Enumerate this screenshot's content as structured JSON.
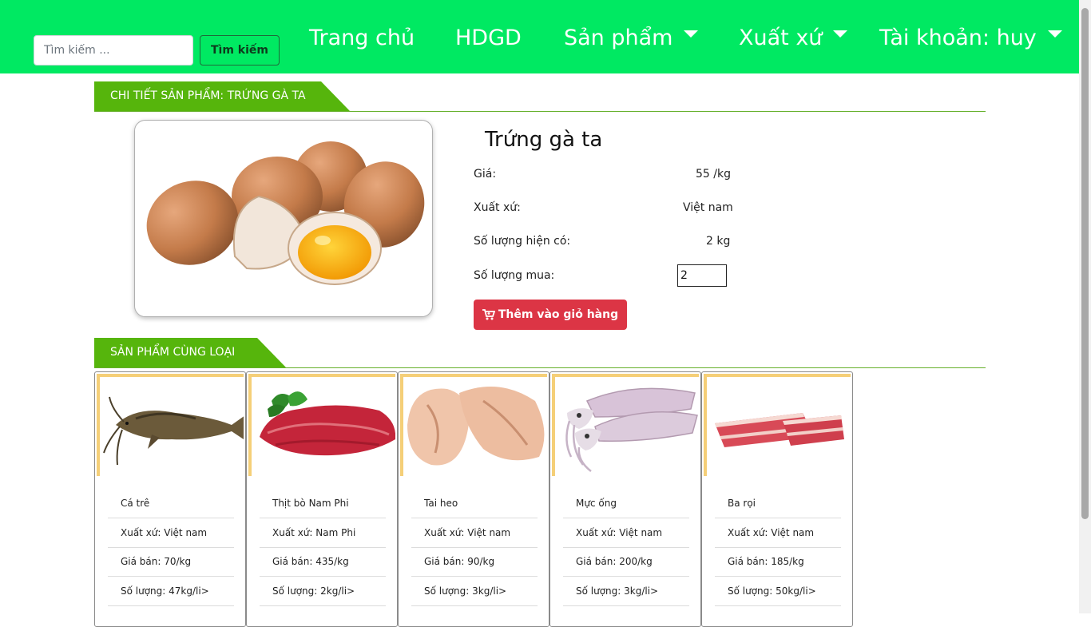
{
  "navbar": {
    "search_placeholder": "Tìm kiếm ...",
    "search_button": "Tìm kiếm",
    "home": "Trang chủ",
    "hdgd": "HDGD",
    "products": "Sản phẩm",
    "origin": "Xuất xứ",
    "account": "Tài khoản: huy",
    "bg_color": "#00e962"
  },
  "detail": {
    "section_title": "CHI TIẾT SẢN PHẨM: TRỨNG GÀ TA",
    "name": "Trứng gà ta",
    "price_label": "Giá:",
    "price_value": "55 /kg",
    "origin_label": "Xuất xứ:",
    "origin_value": "Việt nam",
    "stock_label": "Số lượng hiện có:",
    "stock_value": "2 kg",
    "qty_label": "Số lượng mua:",
    "qty_value": "2",
    "add_to_cart": "Thêm vào giỏ hàng",
    "image_icon": "eggs-image"
  },
  "related": {
    "section_title": "SẢN PHẨM CÙNG LOẠI",
    "items": [
      {
        "name": "Cá trê",
        "origin": "Xuất xứ: Việt nam",
        "price": "Giá bán: 70/kg",
        "qty": "Số lượng: 47kg/li>",
        "image_icon": "catfish-image"
      },
      {
        "name": "Thịt bò Nam Phi",
        "origin": "Xuất xứ: Nam Phi",
        "price": "Giá bán: 435/kg",
        "qty": "Số lượng: 2kg/li>",
        "image_icon": "beef-image"
      },
      {
        "name": "Tai heo",
        "origin": "Xuất xứ: Việt nam",
        "price": "Giá bán: 90/kg",
        "qty": "Số lượng: 3kg/li>",
        "image_icon": "pig-ear-image"
      },
      {
        "name": "Mực ống",
        "origin": "Xuất xứ: Việt nam",
        "price": "Giá bán: 200/kg",
        "qty": "Số lượng: 3kg/li>",
        "image_icon": "squid-image"
      },
      {
        "name": "Ba rọi",
        "origin": "Xuất xứ: Việt nam",
        "price": "Giá bán: 185/kg",
        "qty": "Số lượng: 50kg/li>",
        "image_icon": "pork-belly-image"
      }
    ]
  },
  "colors": {
    "accent_green": "#56b50c",
    "cart_red": "#dc3545",
    "card_accent": "#f5cf78"
  }
}
